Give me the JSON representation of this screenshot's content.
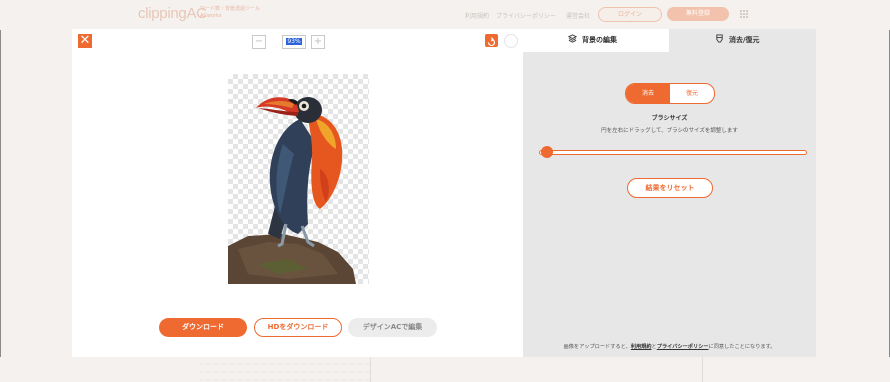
{
  "header": {
    "logo": "clippingAC",
    "logo_tagline": "ワード数・背景透過ツール　ACworks",
    "nav": [
      "利用規約",
      "プライバシーポリシー",
      "運営会社"
    ],
    "login_label": "ログイン",
    "register_label": "無料登録"
  },
  "toolbar": {
    "zoom_minus": "−",
    "zoom_value": "93%",
    "zoom_plus": "+",
    "close_symbol": "✕"
  },
  "actions": {
    "download_label": "ダウンロード",
    "hd_download_label": "HDをダウンロード",
    "designac_label": "デザインACで編集"
  },
  "panel": {
    "tab_background": "背景の編集",
    "tab_erase_restore": "消去/復元",
    "mode_erase": "消去",
    "mode_restore": "復元",
    "brush_size_label": "ブラシサイズ",
    "brush_size_desc": "円を左右にドラッグして、ブラシのサイズを調整します",
    "brush_size_value": 0.03,
    "reset_label": "結果をリセット",
    "terms_prefix": "画像をアップロードすると、",
    "terms_link": "利用規約",
    "terms_and": "と",
    "privacy_link": "プライバシーポリシー",
    "terms_suffix": "に同意したことになります。"
  },
  "colors": {
    "accent": "#ee6a30",
    "panel_bg": "#e7e7e7",
    "page_bg": "#f4f1ee"
  },
  "icons": [
    "close-icon",
    "rotate-icon",
    "redo-icon",
    "layers-icon",
    "eraser-icon",
    "grid-menu-icon"
  ]
}
